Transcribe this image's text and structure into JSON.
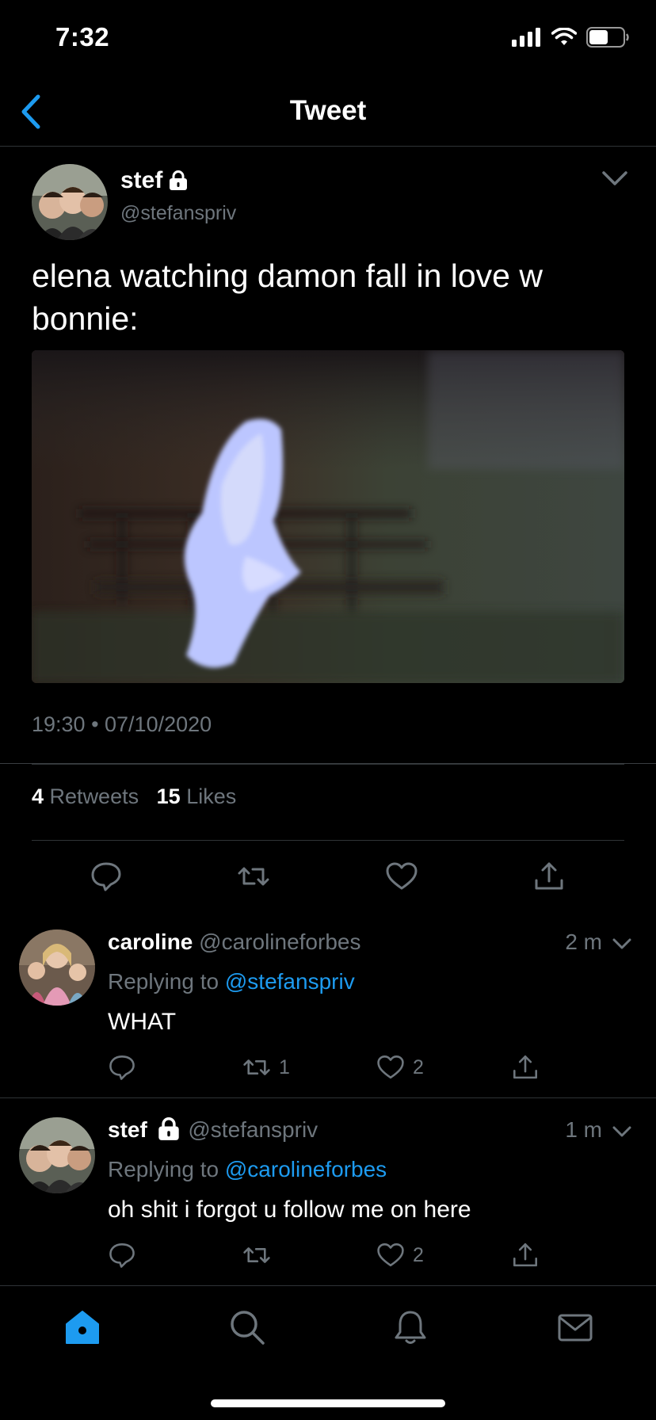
{
  "status_bar": {
    "time": "7:32"
  },
  "nav": {
    "title": "Tweet"
  },
  "main_tweet": {
    "author_name": "stef",
    "author_handle": "@stefanspriv",
    "text": "elena watching damon fall in love w bonnie:",
    "timestamp": "19:30 • 07/10/2020",
    "retweets_count": "4",
    "retweets_label": "Retweets",
    "likes_count": "15",
    "likes_label": "Likes"
  },
  "replies": [
    {
      "name": "caroline",
      "handle": "@carolineforbes",
      "time": "2 m",
      "replying_prefix": "Replying to",
      "replying_to": "@stefanspriv",
      "text": "WHAT",
      "retweets": "1",
      "likes": "2"
    },
    {
      "name": "stef",
      "handle": "@stefanspriv",
      "time": "1 m",
      "replying_prefix": "Replying to",
      "replying_to": "@carolineforbes",
      "text": "oh shit i forgot u follow me on here",
      "retweets": "",
      "likes": "2"
    }
  ],
  "tabbar": {
    "items": [
      "home-icon",
      "search-icon",
      "bell-icon",
      "mail-icon"
    ],
    "active_color": "#1d9bf0"
  },
  "colors": {
    "accent": "#1d9bf0",
    "muted": "#6e767d",
    "background": "#000000"
  }
}
